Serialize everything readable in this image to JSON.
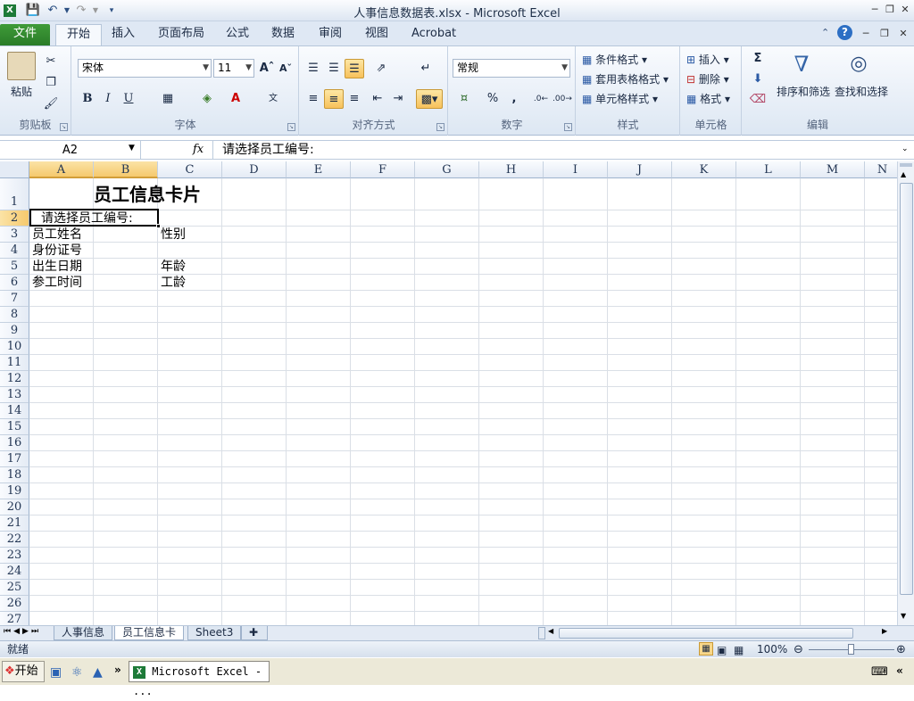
{
  "window": {
    "title": "人事信息数据表.xlsx - Microsoft Excel"
  },
  "ribbon_tabs": [
    "文件",
    "开始",
    "插入",
    "页面布局",
    "公式",
    "数据",
    "审阅",
    "视图",
    "Acrobat"
  ],
  "active_tab": "开始",
  "clipboard": {
    "paste_label": "粘贴",
    "group_label": "剪贴板"
  },
  "font": {
    "name": "宋体",
    "size": "11",
    "bold": "B",
    "italic": "I",
    "underline": "U",
    "group_label": "字体"
  },
  "alignment": {
    "group_label": "对齐方式"
  },
  "number": {
    "format": "常规",
    "percent": "%",
    "comma": ",",
    "group_label": "数字"
  },
  "styles": {
    "conditional": "条件格式",
    "table": "套用表格格式",
    "cell": "单元格样式",
    "group_label": "样式"
  },
  "cells_group": {
    "insert": "插入",
    "delete": "删除",
    "format": "格式",
    "group_label": "单元格"
  },
  "editing": {
    "sigma": "Σ",
    "sort_filter": "排序和筛选",
    "find_select": "查找和选择",
    "group_label": "编辑"
  },
  "formula_bar": {
    "name_box": "A2",
    "fx": "fx",
    "content": "请选择员工编号:"
  },
  "columns": [
    "A",
    "B",
    "C",
    "D",
    "E",
    "F",
    "G",
    "H",
    "I",
    "J",
    "K",
    "L",
    "M",
    "N"
  ],
  "rows": [
    "1",
    "2",
    "3",
    "4",
    "5",
    "6",
    "7",
    "8",
    "9",
    "10",
    "11",
    "12",
    "13",
    "14",
    "15",
    "16",
    "17",
    "18",
    "19",
    "20",
    "21",
    "22",
    "23",
    "24",
    "25",
    "26",
    "27"
  ],
  "cells": {
    "title": "员工信息卡片",
    "a2": "请选择员工编号:",
    "a3": "员工姓名",
    "c3": "性别",
    "a4": "身份证号",
    "a5": "出生日期",
    "c5": "年龄",
    "a6": "参工时间",
    "c6": "工龄"
  },
  "sheet_tabs": [
    "人事信息",
    "员工信息卡",
    "Sheet3"
  ],
  "active_sheet": "员工信息卡",
  "status": {
    "mode": "就绪",
    "zoom": "100%"
  },
  "taskbar": {
    "start": "开始",
    "item": "Microsoft Excel - ..."
  },
  "colors": {
    "file_tab": "#2a7c28",
    "selected_header": "#f5c96d",
    "ribbon": "#dde7f3"
  }
}
